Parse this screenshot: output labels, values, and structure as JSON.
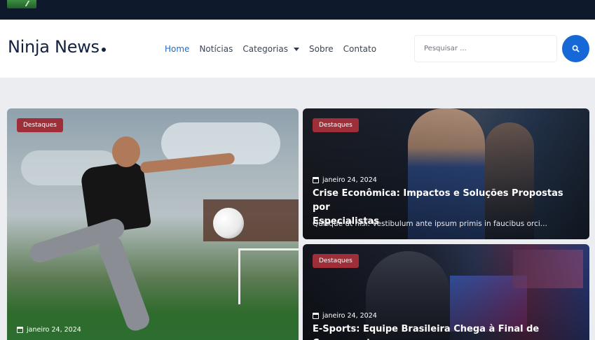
{
  "header": {
    "logo_text": "Ninja News",
    "nav": [
      {
        "label": "Home",
        "active": true
      },
      {
        "label": "Notícias"
      },
      {
        "label": "Categorias",
        "has_dropdown": true
      },
      {
        "label": "Sobre"
      },
      {
        "label": "Contato"
      }
    ],
    "search": {
      "placeholder": "Pesquisar ..."
    }
  },
  "cards": [
    {
      "badge": "Destaques",
      "date": "janeiro 24, 2024",
      "title": "",
      "excerpt": ""
    },
    {
      "badge": "Destaques",
      "date": "janeiro 24, 2024",
      "title_line1": "Crise Econômica: Impactos e Soluções Propostas por",
      "title_line2": "Especialistas",
      "excerpt": "Quisque ut nisi. Vestibulum ante ipsum primis in faucibus orci..."
    },
    {
      "badge": "Destaques",
      "date": "janeiro 24, 2024",
      "title_line1": "E-Sports: Equipe Brasileira Chega à Final de Campeonato"
    }
  ],
  "colors": {
    "topbar": "#0e1a2b",
    "accent": "#1668d6",
    "badge": "#9e2e37",
    "logo": "#13233f"
  }
}
